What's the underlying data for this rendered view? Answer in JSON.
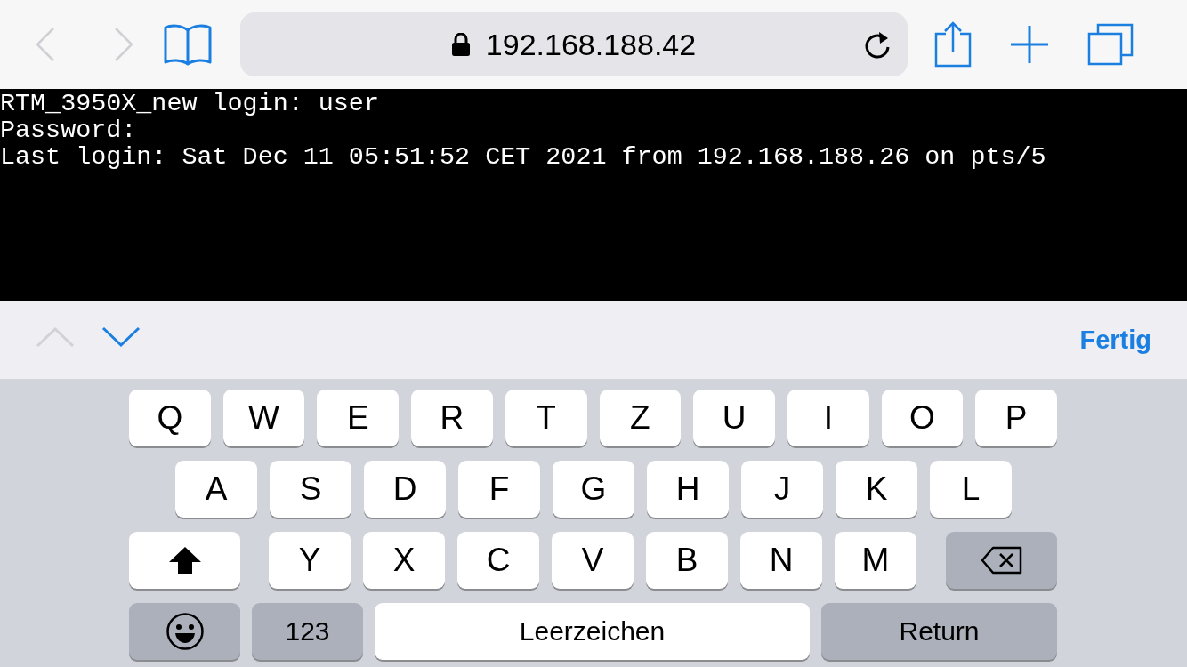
{
  "toolbar": {
    "back": {
      "disabled": true
    },
    "forward": {
      "disabled": true
    },
    "address": "192.168.188.42"
  },
  "terminal": {
    "lines": [
      "RTM_3950X_new login: user",
      "Password:",
      "Last login: Sat Dec 11 05:51:52 CET 2021 from 192.168.188.26 on pts/5"
    ]
  },
  "accessory_bar": {
    "previous": {
      "disabled": true
    },
    "next": {
      "disabled": false
    },
    "done": "Fertig"
  },
  "keyboard": {
    "rows": [
      {
        "keys": [
          {
            "kind": "letter",
            "label": "Q"
          },
          {
            "kind": "letter",
            "label": "W"
          },
          {
            "kind": "letter",
            "label": "E"
          },
          {
            "kind": "letter",
            "label": "R"
          },
          {
            "kind": "letter",
            "label": "T"
          },
          {
            "kind": "letter",
            "label": "Z"
          },
          {
            "kind": "letter",
            "label": "U"
          },
          {
            "kind": "letter",
            "label": "I"
          },
          {
            "kind": "letter",
            "label": "O"
          },
          {
            "kind": "letter",
            "label": "P"
          }
        ]
      },
      {
        "keys": [
          {
            "kind": "letter",
            "label": "A"
          },
          {
            "kind": "letter",
            "label": "S"
          },
          {
            "kind": "letter",
            "label": "D"
          },
          {
            "kind": "letter",
            "label": "F"
          },
          {
            "kind": "letter",
            "label": "G"
          },
          {
            "kind": "letter",
            "label": "H"
          },
          {
            "kind": "letter",
            "label": "J"
          },
          {
            "kind": "letter",
            "label": "K"
          },
          {
            "kind": "letter",
            "label": "L"
          }
        ]
      },
      {
        "keys": [
          {
            "kind": "shift"
          },
          {
            "kind": "letter",
            "label": "Y"
          },
          {
            "kind": "letter",
            "label": "X"
          },
          {
            "kind": "letter",
            "label": "C"
          },
          {
            "kind": "letter",
            "label": "V"
          },
          {
            "kind": "letter",
            "label": "B"
          },
          {
            "kind": "letter",
            "label": "N"
          },
          {
            "kind": "letter",
            "label": "M"
          },
          {
            "kind": "delete"
          }
        ]
      },
      {
        "keys": [
          {
            "kind": "emoji"
          },
          {
            "kind": "numbers",
            "label": "123"
          },
          {
            "kind": "space",
            "label": "Leerzeichen"
          },
          {
            "kind": "return",
            "label": "Return"
          }
        ]
      }
    ]
  }
}
